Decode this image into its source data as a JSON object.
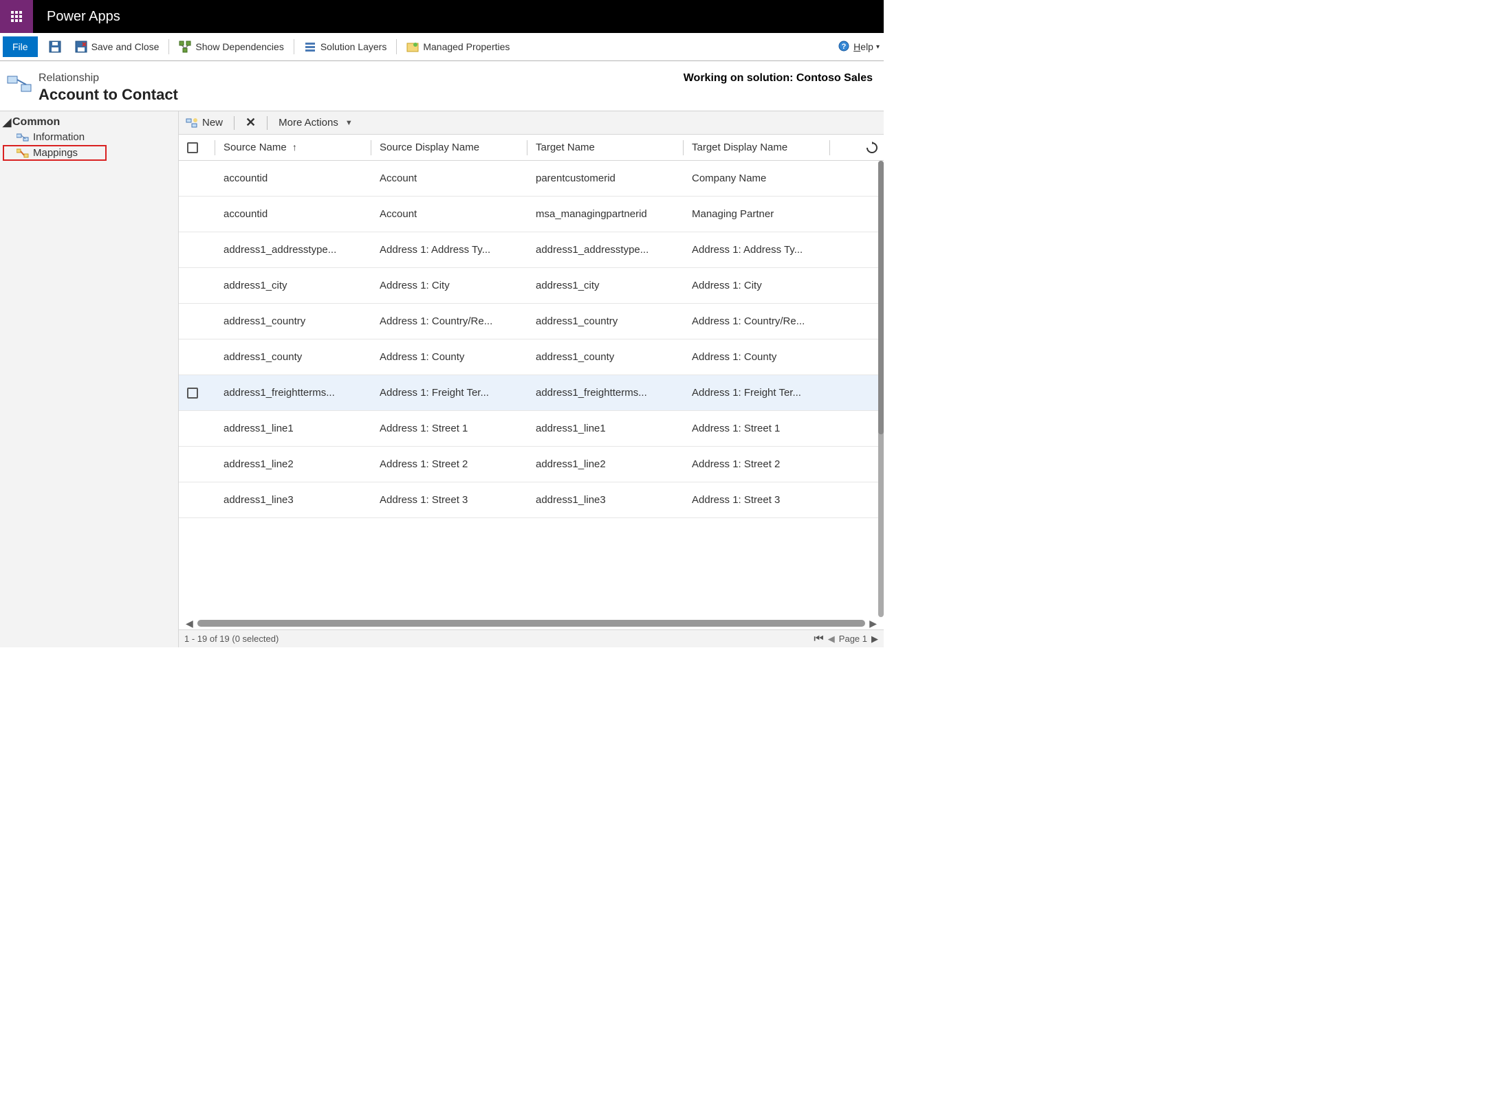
{
  "topbar": {
    "product": "Power Apps"
  },
  "ribbon": {
    "file": "File",
    "save_close": "Save and Close",
    "show_dependencies": "Show Dependencies",
    "solution_layers": "Solution Layers",
    "managed_properties": "Managed Properties",
    "help": "Help"
  },
  "header": {
    "eyebrow": "Relationship",
    "title": "Account to Contact",
    "status": "Working on solution: Contoso Sales"
  },
  "sidebar": {
    "group": "Common",
    "items": [
      {
        "label": "Information"
      },
      {
        "label": "Mappings"
      }
    ]
  },
  "grid_toolbar": {
    "new": "New",
    "more_actions": "More Actions"
  },
  "columns": {
    "c1": "Source Name",
    "c2": "Source Display Name",
    "c3": "Target Name",
    "c4": "Target Display Name"
  },
  "rows": [
    {
      "c1": "accountid",
      "c2": "Account",
      "c3": "parentcustomerid",
      "c4": "Company Name",
      "hl": false,
      "cb": false
    },
    {
      "c1": "accountid",
      "c2": "Account",
      "c3": "msa_managingpartnerid",
      "c4": "Managing Partner",
      "hl": false,
      "cb": false
    },
    {
      "c1": "address1_addresstype...",
      "c2": "Address 1: Address Ty...",
      "c3": "address1_addresstype...",
      "c4": "Address 1: Address Ty...",
      "hl": false,
      "cb": false
    },
    {
      "c1": "address1_city",
      "c2": "Address 1: City",
      "c3": "address1_city",
      "c4": "Address 1: City",
      "hl": false,
      "cb": false
    },
    {
      "c1": "address1_country",
      "c2": "Address 1: Country/Re...",
      "c3": "address1_country",
      "c4": "Address 1: Country/Re...",
      "hl": false,
      "cb": false
    },
    {
      "c1": "address1_county",
      "c2": "Address 1: County",
      "c3": "address1_county",
      "c4": "Address 1: County",
      "hl": false,
      "cb": false
    },
    {
      "c1": "address1_freightterms...",
      "c2": "Address 1: Freight Ter...",
      "c3": "address1_freightterms...",
      "c4": "Address 1: Freight Ter...",
      "hl": true,
      "cb": true
    },
    {
      "c1": "address1_line1",
      "c2": "Address 1: Street 1",
      "c3": "address1_line1",
      "c4": "Address 1: Street 1",
      "hl": false,
      "cb": false
    },
    {
      "c1": "address1_line2",
      "c2": "Address 1: Street 2",
      "c3": "address1_line2",
      "c4": "Address 1: Street 2",
      "hl": false,
      "cb": false
    },
    {
      "c1": "address1_line3",
      "c2": "Address 1: Street 3",
      "c3": "address1_line3",
      "c4": "Address 1: Street 3",
      "hl": false,
      "cb": false
    }
  ],
  "footer": {
    "status": "1 - 19 of 19 (0 selected)",
    "page": "Page 1"
  }
}
